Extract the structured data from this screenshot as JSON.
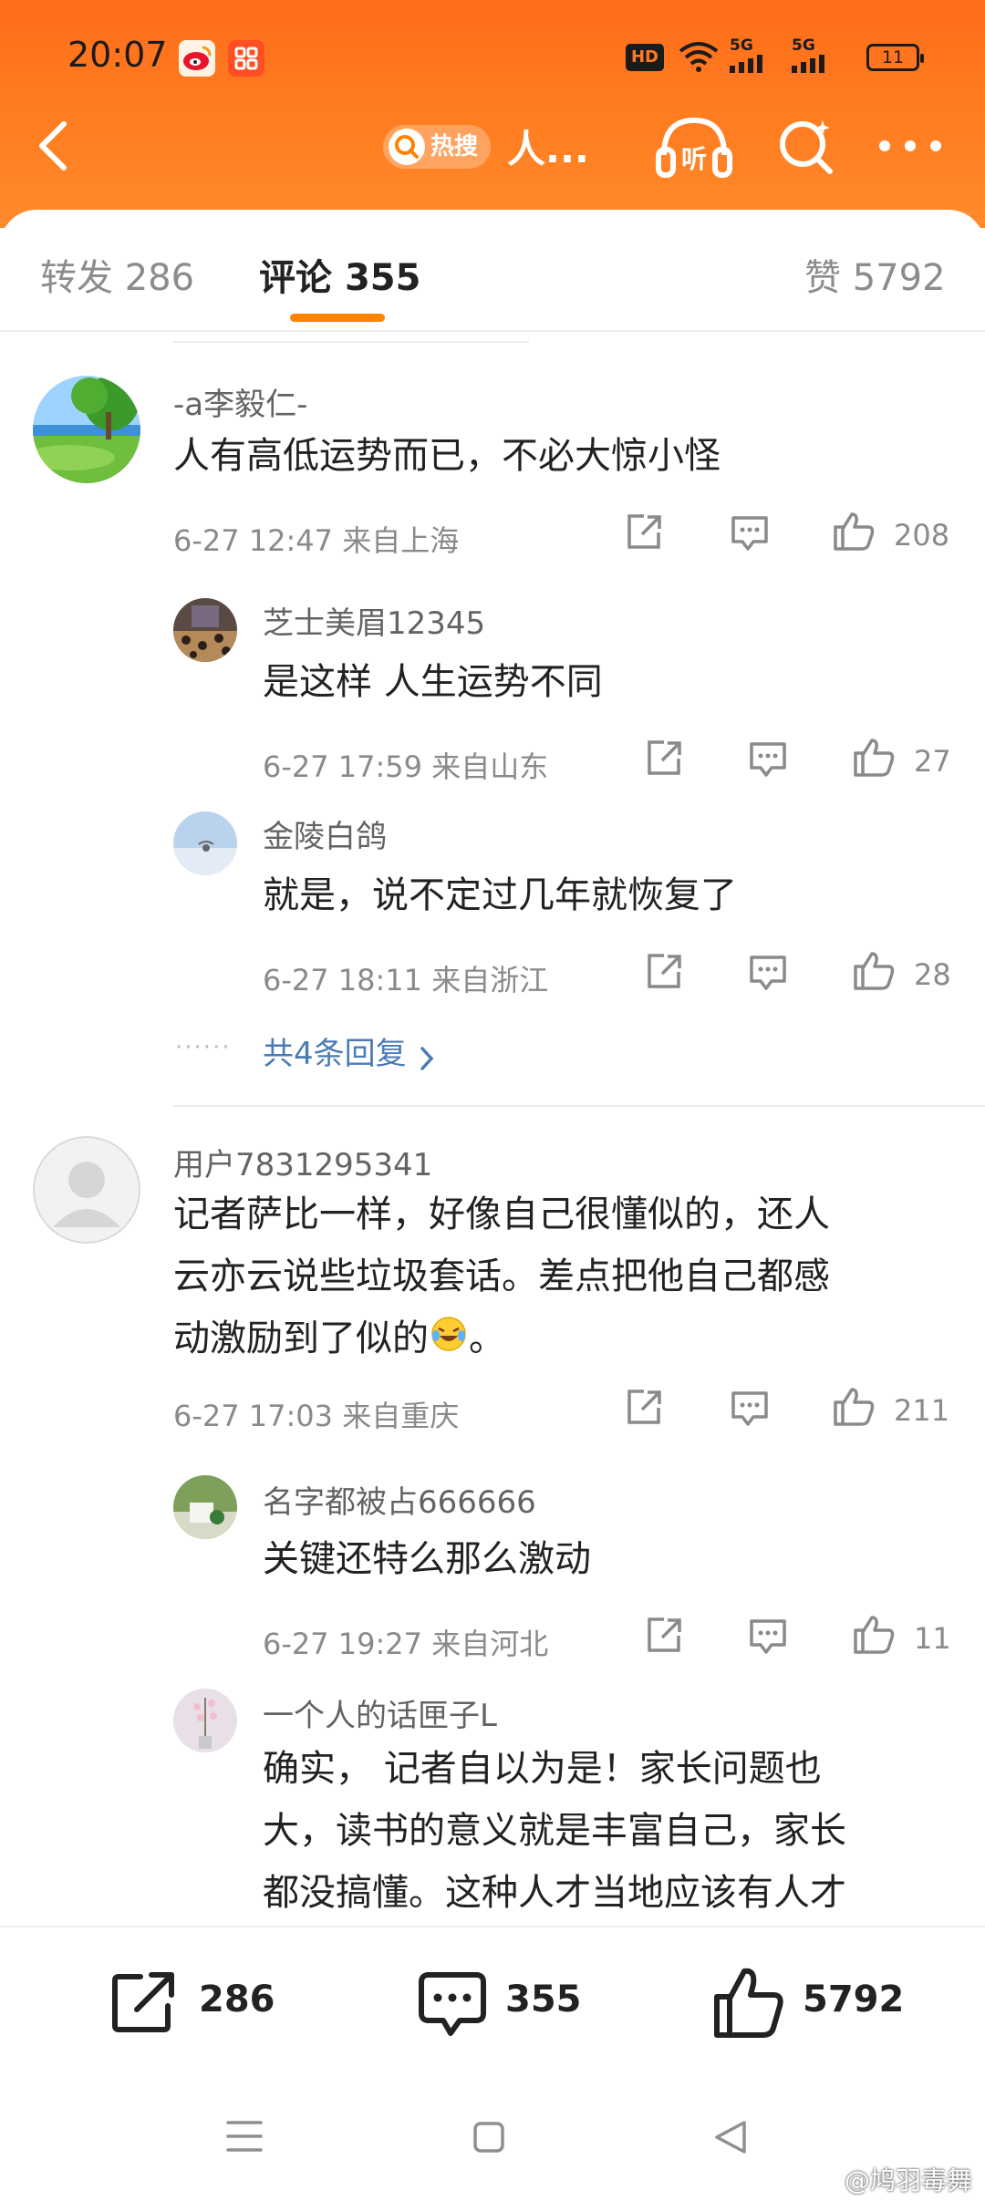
{
  "status_bar": {
    "time": "20:07",
    "battery": "11",
    "signal_a": "5G",
    "signal_b": "5G",
    "hd_label": "HD"
  },
  "header": {
    "hot_label": "热搜",
    "title": "人..."
  },
  "tabs": [
    {
      "label": "转发",
      "count": "286"
    },
    {
      "label": "评论",
      "count": "355"
    },
    {
      "label": "赞",
      "count": "5792"
    }
  ],
  "comments": [
    {
      "user": "-a李毅仁-",
      "text": "人有高低运势而已，不必大惊小怪",
      "meta": "6-27 12:47  来自上海",
      "likes": "208",
      "replies": [
        {
          "user": "芝士美眉12345",
          "text": "是这样 人生运势不同",
          "meta": "6-27 17:59  来自山东",
          "likes": "27"
        },
        {
          "user": "金陵白鸽",
          "text": "就是，说不定过几年就恢复了",
          "meta": "6-27 18:11  来自浙江",
          "likes": "28"
        }
      ],
      "more_replies": "共4条回复",
      "more_dots": "······"
    },
    {
      "user": "用户7831295341",
      "text_lines": [
        "记者萨比一样，好像自己很懂似的，还人",
        "云亦云说些垃圾套话。差点把他自己都感",
        "动激励到了似的"
      ],
      "text_end": "。",
      "meta": "6-27 17:03  来自重庆",
      "likes": "211",
      "replies": [
        {
          "user": "名字都被占666666",
          "text": "关键还特么那么激动",
          "meta": "6-27 19:27  来自河北",
          "likes": "11"
        },
        {
          "user": "一个人的话匣子L",
          "text_lines": [
            "确实， 记者自以为是！家长问题也",
            "大，读书的意义就是丰富自己，家长",
            "都没搞懂。这种人才当地应该有人才"
          ]
        }
      ]
    }
  ],
  "bottom_bar": {
    "repost": "286",
    "comment": "355",
    "like": "5792"
  },
  "watermark": "@鸠羽毒舞",
  "colors": {
    "accent": "#ff8200",
    "header": "#ff7a1f",
    "link": "#4a7bb5"
  }
}
